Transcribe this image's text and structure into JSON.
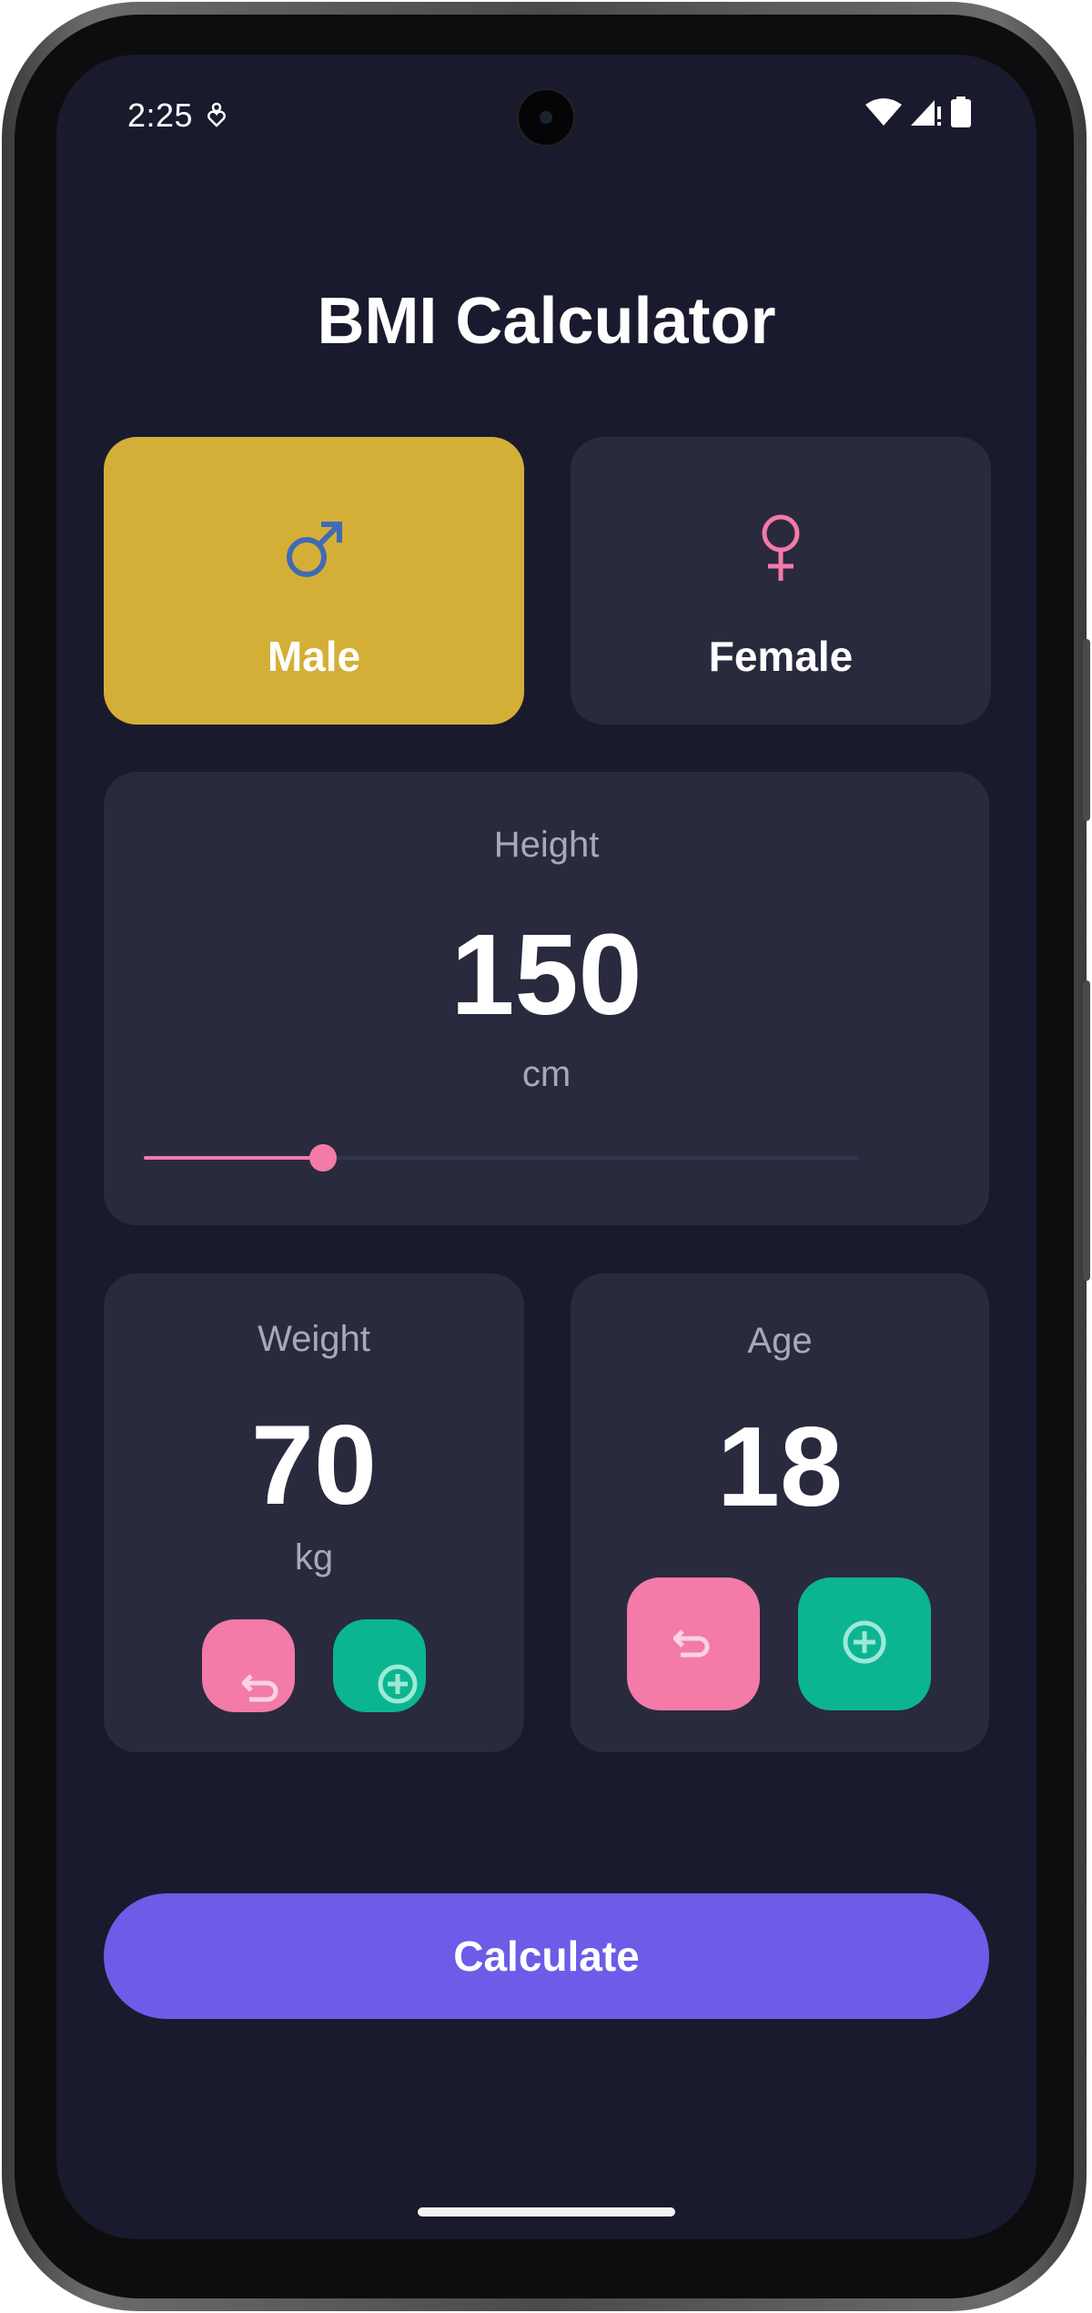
{
  "status_bar": {
    "time": "2:25",
    "left_icons": [
      "do-not-disturb-icon"
    ],
    "right_icons": [
      "wifi-icon",
      "cell-signal-icon",
      "battery-icon"
    ]
  },
  "app": {
    "title": "BMI Calculator"
  },
  "gender": {
    "selected": "male",
    "options": [
      {
        "id": "male",
        "label": "Male",
        "icon": "male-icon",
        "icon_color": "#3f6bb5",
        "card_color": "#d4af37"
      },
      {
        "id": "female",
        "label": "Female",
        "icon": "female-icon",
        "icon_color": "#f47aa8",
        "card_color": "#292a3e"
      }
    ]
  },
  "height": {
    "label": "Height",
    "value": "150",
    "unit": "cm",
    "slider_fraction": 0.25
  },
  "weight": {
    "label": "Weight",
    "value": "70",
    "unit": "kg",
    "decrement_icon": "undo-icon",
    "increment_icon": "add-circle-icon"
  },
  "age": {
    "label": "Age",
    "value": "18",
    "decrement_icon": "undo-icon",
    "increment_icon": "add-circle-icon"
  },
  "calculate_button": {
    "label": "Calculate"
  },
  "colors": {
    "background": "#1a1a2e",
    "card": "#292a3e",
    "accent_gold": "#d4af37",
    "accent_pink": "#f47aa8",
    "accent_green": "#0bb592",
    "primary_button": "#6c5ce7"
  }
}
